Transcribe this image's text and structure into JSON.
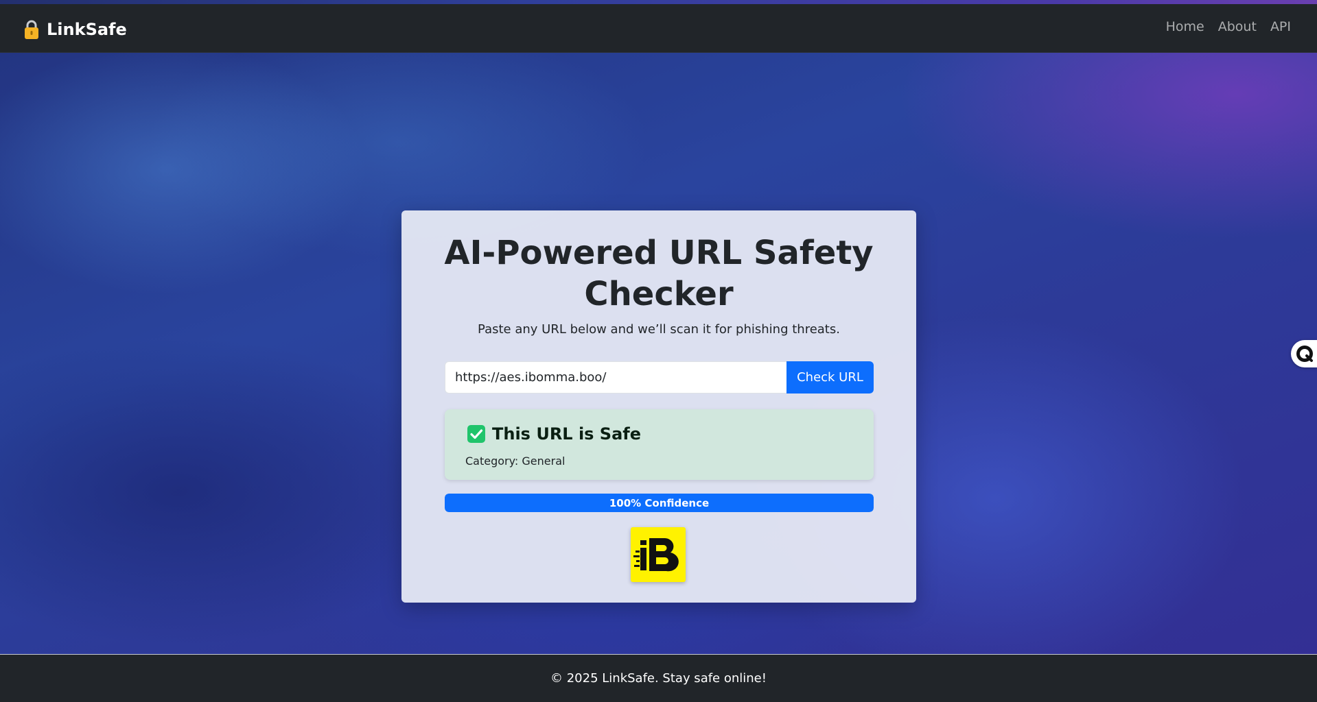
{
  "navbar": {
    "brand": "LinkSafe",
    "brand_icon": "lock-icon",
    "links": [
      {
        "label": "Home"
      },
      {
        "label": "About"
      },
      {
        "label": "API"
      }
    ]
  },
  "checker": {
    "title": "AI-Powered URL Safety Checker",
    "subtitle": "Paste any URL below and we’ll scan it for phishing threats.",
    "url_value": "https://aes.ibomma.boo/",
    "submit_label": "Check URL"
  },
  "result": {
    "status_icon": "check-square-icon",
    "title": "This URL is Safe",
    "category": "Category: General",
    "confidence_label": "100% Confidence",
    "confidence_percent": 100
  },
  "site_logo": {
    "icon": "ibomma-logo"
  },
  "footer": {
    "text": "© 2025 LinkSafe. Stay safe online!"
  },
  "colors": {
    "primary": "#0d6efd",
    "navbar": "#212529",
    "success_bg": "#d1e7dd",
    "success_icon": "#20c46b",
    "logo_bg": "#fff200"
  }
}
